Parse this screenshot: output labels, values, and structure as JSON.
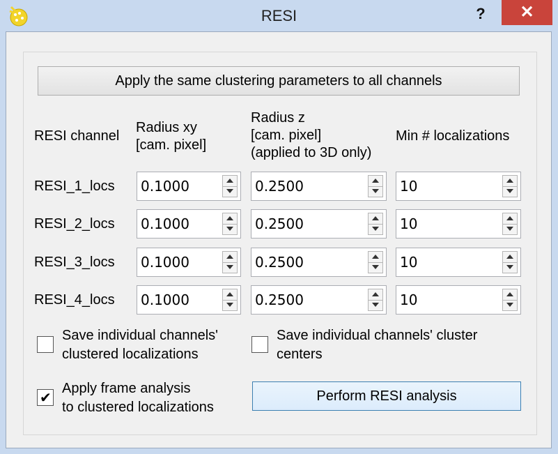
{
  "window": {
    "title": "RESI",
    "help_label": "?",
    "close_label": "✕"
  },
  "apply_same_button": "Apply the same clustering parameters to all channels",
  "headers": {
    "channel": "RESI channel",
    "radius_xy_line1": "Radius xy",
    "radius_xy_line2": "[cam.  pixel]",
    "radius_z_line1": "Radius z",
    "radius_z_line2": "[cam.  pixel]",
    "radius_z_line3": "(applied to 3D only)",
    "min_locs": "Min # localizations"
  },
  "rows": [
    {
      "channel": "RESI_1_locs",
      "radius_xy": "0.1000",
      "radius_z": "0.2500",
      "min_locs": "10"
    },
    {
      "channel": "RESI_2_locs",
      "radius_xy": "0.1000",
      "radius_z": "0.2500",
      "min_locs": "10"
    },
    {
      "channel": "RESI_3_locs",
      "radius_xy": "0.1000",
      "radius_z": "0.2500",
      "min_locs": "10"
    },
    {
      "channel": "RESI_4_locs",
      "radius_xy": "0.1000",
      "radius_z": "0.2500",
      "min_locs": "10"
    }
  ],
  "options": {
    "save_clustered_line1": "Save individual channels'",
    "save_clustered_line2": "clustered localizations",
    "save_clustered_checked": false,
    "save_centers_line1": "Save individual channels' cluster",
    "save_centers_line2": "centers",
    "save_centers_checked": false,
    "frame_analysis_line1": "Apply frame analysis",
    "frame_analysis_line2": "to clustered localizations",
    "frame_analysis_checked": true,
    "check_mark": "✔"
  },
  "perform_button": "Perform RESI analysis",
  "colors": {
    "titlebar": "#c8d9ef",
    "close": "#c9443b",
    "primary_border": "#3c7fb1"
  }
}
